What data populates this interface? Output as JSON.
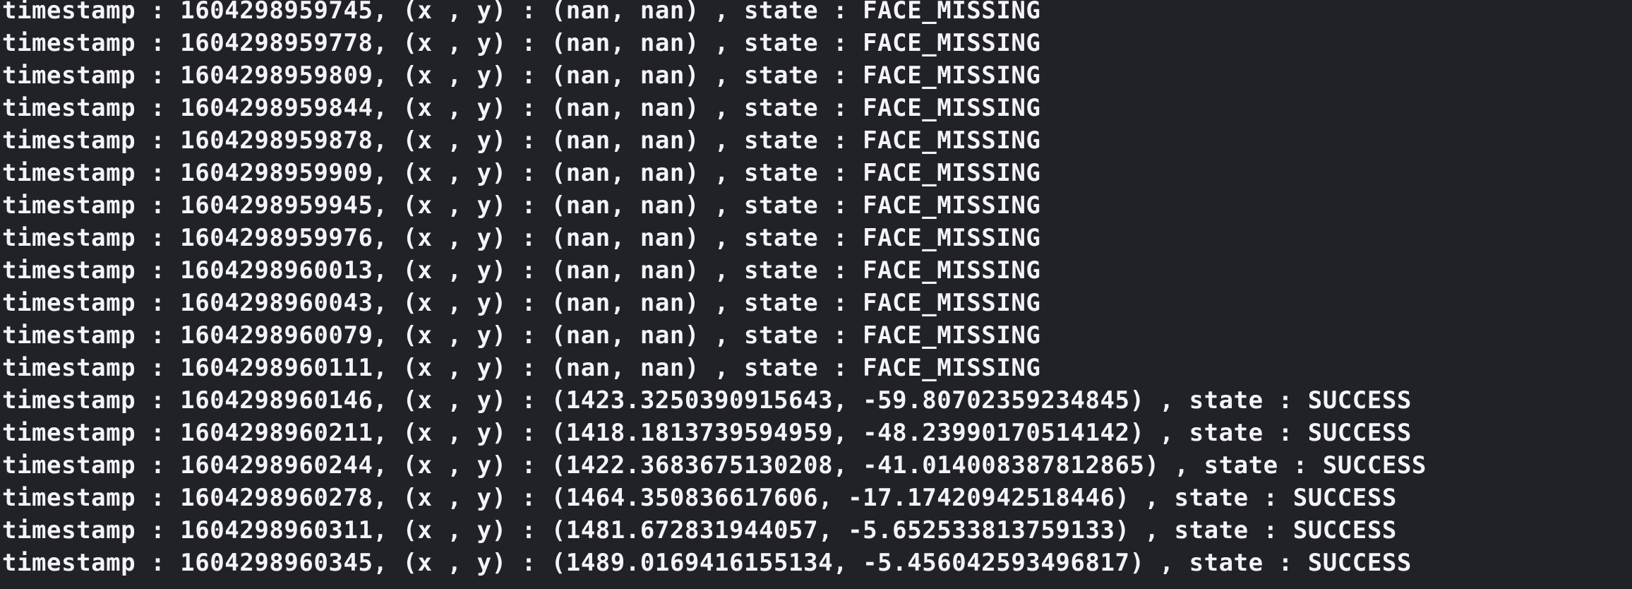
{
  "terminal": {
    "background_color": "#212228",
    "text_color": "#f4f4f6",
    "font_size_px": 34,
    "line_height_px": 46,
    "label_timestamp": "timestamp",
    "label_xy": "(x , y)",
    "label_state": "state",
    "separator": " : ",
    "state_face_missing": "FACE_MISSING",
    "state_success": "SUCCESS",
    "nan_pair": "(nan, nan)"
  },
  "log": {
    "lines": [
      "timestamp : 1604298959745, (x , y) : (nan, nan) , state : FACE_MISSING",
      "timestamp : 1604298959778, (x , y) : (nan, nan) , state : FACE_MISSING",
      "timestamp : 1604298959809, (x , y) : (nan, nan) , state : FACE_MISSING",
      "timestamp : 1604298959844, (x , y) : (nan, nan) , state : FACE_MISSING",
      "timestamp : 1604298959878, (x , y) : (nan, nan) , state : FACE_MISSING",
      "timestamp : 1604298959909, (x , y) : (nan, nan) , state : FACE_MISSING",
      "timestamp : 1604298959945, (x , y) : (nan, nan) , state : FACE_MISSING",
      "timestamp : 1604298959976, (x , y) : (nan, nan) , state : FACE_MISSING",
      "timestamp : 1604298960013, (x , y) : (nan, nan) , state : FACE_MISSING",
      "timestamp : 1604298960043, (x , y) : (nan, nan) , state : FACE_MISSING",
      "timestamp : 1604298960079, (x , y) : (nan, nan) , state : FACE_MISSING",
      "timestamp : 1604298960111, (x , y) : (nan, nan) , state : FACE_MISSING",
      "timestamp : 1604298960146, (x , y) : (1423.3250390915643, -59.80702359234845) , state : SUCCESS",
      "timestamp : 1604298960211, (x , y) : (1418.1813739594959, -48.23990170514142) , state : SUCCESS",
      "timestamp : 1604298960244, (x , y) : (1422.3683675130208, -41.014008387812865) , state : SUCCESS",
      "timestamp : 1604298960278, (x , y) : (1464.350836617606, -17.17420942518446) , state : SUCCESS",
      "timestamp : 1604298960311, (x , y) : (1481.672831944057, -5.652533813759133) , state : SUCCESS",
      "timestamp : 1604298960345, (x , y) : (1489.0169416155134, -5.456042593496817) , state : SUCCESS"
    ],
    "records": [
      {
        "timestamp": "1604298959745",
        "x": "nan",
        "y": "nan",
        "state": "FACE_MISSING"
      },
      {
        "timestamp": "1604298959778",
        "x": "nan",
        "y": "nan",
        "state": "FACE_MISSING"
      },
      {
        "timestamp": "1604298959809",
        "x": "nan",
        "y": "nan",
        "state": "FACE_MISSING"
      },
      {
        "timestamp": "1604298959844",
        "x": "nan",
        "y": "nan",
        "state": "FACE_MISSING"
      },
      {
        "timestamp": "1604298959878",
        "x": "nan",
        "y": "nan",
        "state": "FACE_MISSING"
      },
      {
        "timestamp": "1604298959909",
        "x": "nan",
        "y": "nan",
        "state": "FACE_MISSING"
      },
      {
        "timestamp": "1604298959945",
        "x": "nan",
        "y": "nan",
        "state": "FACE_MISSING"
      },
      {
        "timestamp": "1604298959976",
        "x": "nan",
        "y": "nan",
        "state": "FACE_MISSING"
      },
      {
        "timestamp": "1604298960013",
        "x": "nan",
        "y": "nan",
        "state": "FACE_MISSING"
      },
      {
        "timestamp": "1604298960043",
        "x": "nan",
        "y": "nan",
        "state": "FACE_MISSING"
      },
      {
        "timestamp": "1604298960079",
        "x": "nan",
        "y": "nan",
        "state": "FACE_MISSING"
      },
      {
        "timestamp": "1604298960111",
        "x": "nan",
        "y": "nan",
        "state": "FACE_MISSING"
      },
      {
        "timestamp": "1604298960146",
        "x": "1423.3250390915643",
        "y": "-59.80702359234845",
        "state": "SUCCESS"
      },
      {
        "timestamp": "1604298960211",
        "x": "1418.1813739594959",
        "y": "-48.23990170514142",
        "state": "SUCCESS"
      },
      {
        "timestamp": "1604298960244",
        "x": "1422.3683675130208",
        "y": "-41.014008387812865",
        "state": "SUCCESS"
      },
      {
        "timestamp": "1604298960278",
        "x": "1464.350836617606",
        "y": "-17.17420942518446",
        "state": "SUCCESS"
      },
      {
        "timestamp": "1604298960311",
        "x": "1481.672831944057",
        "y": "-5.652533813759133",
        "state": "SUCCESS"
      },
      {
        "timestamp": "1604298960345",
        "x": "1489.0169416155134",
        "y": "-5.456042593496817",
        "state": "SUCCESS"
      }
    ]
  }
}
